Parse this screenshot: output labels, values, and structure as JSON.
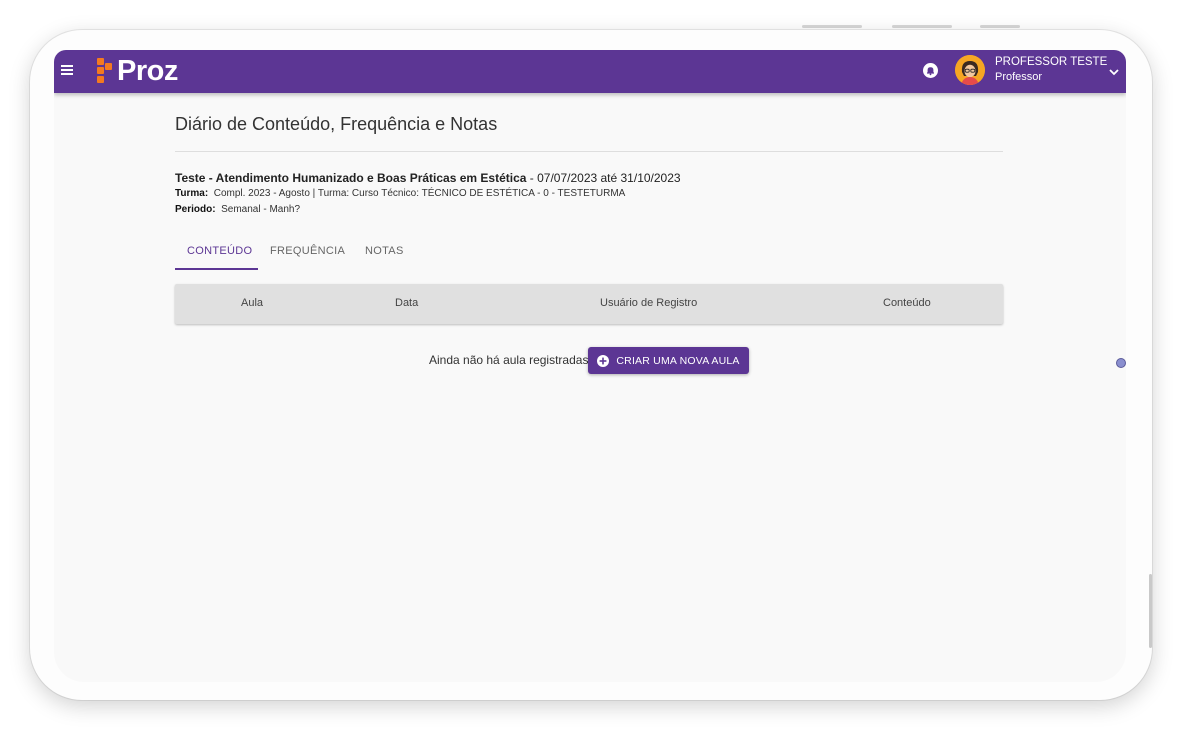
{
  "header": {
    "logo_text": "Proz",
    "user_name": "PROFESSOR TESTE",
    "user_role": "Professor",
    "brand_color": "#5c3694",
    "logo_accent": "#f47a20"
  },
  "page": {
    "title": "Diário de Conteúdo, Frequência e Notas"
  },
  "course": {
    "name": "Teste - Atendimento Humanizado e Boas Práticas em Estética",
    "date_range": " - 07/07/2023 até 31/10/2023",
    "turma_label": "Turma:",
    "turma_value": "Compl. 2023 - Agosto | Turma: Curso Técnico: TÉCNICO DE ESTÉTICA - 0 - TESTETURMA",
    "periodo_label": "Periodo:",
    "periodo_value": "Semanal - Manh?"
  },
  "tabs": [
    {
      "label": "CONTEÚDO",
      "active": true
    },
    {
      "label": "FREQUÊNCIA",
      "active": false
    },
    {
      "label": "NOTAS",
      "active": false
    }
  ],
  "table": {
    "columns": [
      "Aula",
      "Data",
      "Usuário de Registro",
      "Conteúdo"
    ],
    "empty_message": "Ainda não há aula registradas",
    "create_button_label": "CRIAR UMA NOVA AULA"
  },
  "icons": {
    "menu": "hamburger-menu-icon",
    "bell": "bell-icon",
    "chevron": "chevron-down-icon",
    "add": "plus-circle-icon"
  }
}
